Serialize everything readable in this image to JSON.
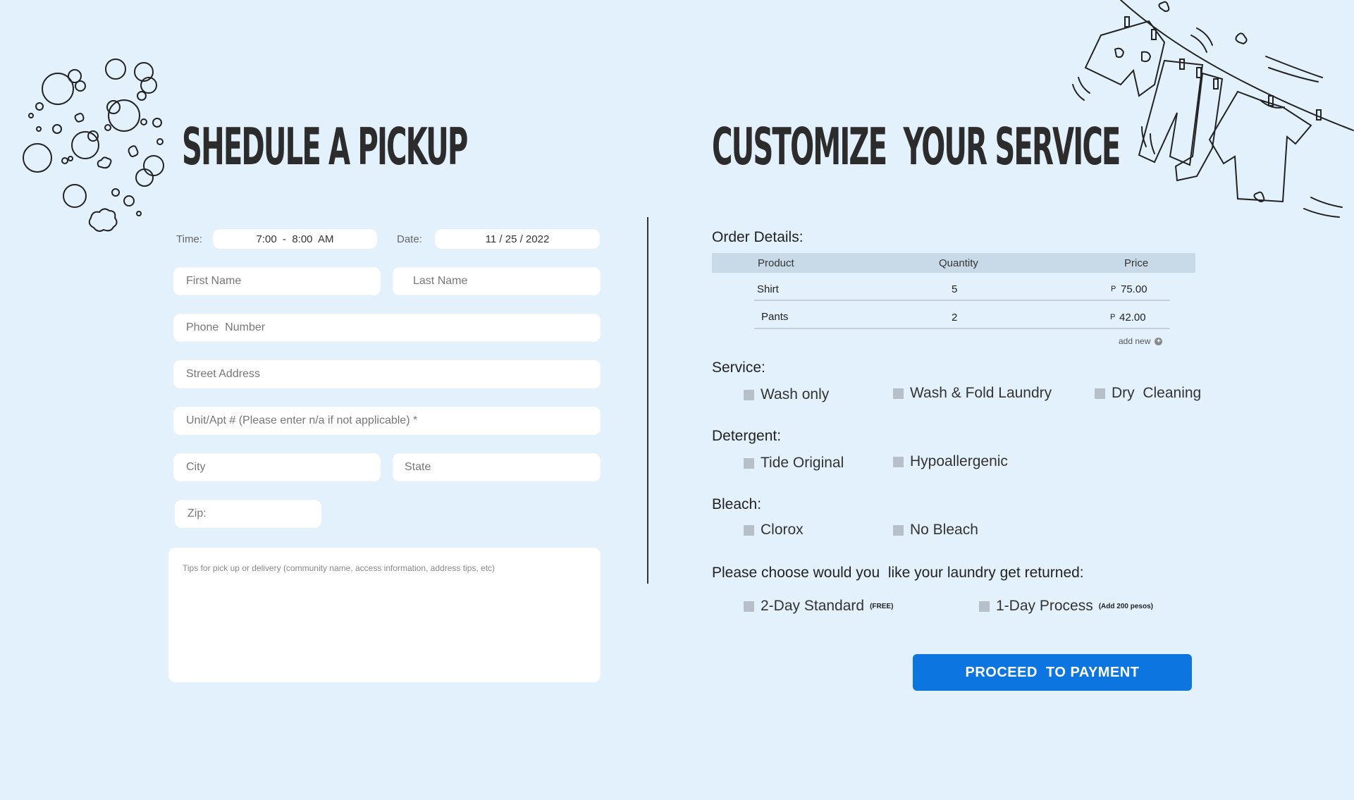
{
  "left": {
    "title": "SHEDULE A PICKUP",
    "time_label": "Time:",
    "time_value": "7:00  -  8:00  AM",
    "date_label": "Date:",
    "date_value": "11 / 25 / 2022",
    "first_name_placeholder": "First Name",
    "last_name_placeholder": "Last Name",
    "phone_placeholder": "Phone  Number",
    "street_placeholder": "Street Address",
    "unit_placeholder": "Unit/Apt # (Please enter n/a if not applicable) *",
    "city_placeholder": "City",
    "state_placeholder": "State",
    "zip_placeholder": "Zip:",
    "tips_placeholder": "Tips for pick up or delivery (community name, access information, address tips, etc)"
  },
  "right": {
    "title": "CUSTOMIZE  YOUR SERVICE",
    "order_label": "Order Details:",
    "table": {
      "headers": [
        "Product",
        "Quantity",
        "Price"
      ],
      "rows": [
        {
          "product": "Shirt",
          "quantity": "5",
          "currency": "P",
          "price": "75.00"
        },
        {
          "product": "Pants",
          "quantity": "2",
          "currency": "P",
          "price": "42.00"
        }
      ],
      "add_new": "add new"
    },
    "service": {
      "label": "Service:",
      "options": [
        "Wash only",
        "Wash & Fold Laundry",
        "Dry  Cleaning"
      ]
    },
    "detergent": {
      "label": "Detergent:",
      "options": [
        "Tide Original",
        "Hypoallergenic"
      ]
    },
    "bleach": {
      "label": "Bleach:",
      "options": [
        "Clorox",
        "No Bleach"
      ]
    },
    "return": {
      "label": "Please choose would you  like your laundry get returned:",
      "options": [
        {
          "label": "2-Day Standard",
          "tag": "(FREE)"
        },
        {
          "label": "1-Day Process",
          "tag": "(Add 200 pesos)"
        }
      ]
    },
    "proceed_label": "PROCEED  TO PAYMENT"
  },
  "colors": {
    "background": "#e3f1fc",
    "accent": "#0c75e0",
    "table_header": "#c8d9e8",
    "checkbox": "#b7bfc8"
  },
  "icons": [
    "bubbles-illustration",
    "clothesline-illustration",
    "plus-circle-icon"
  ]
}
